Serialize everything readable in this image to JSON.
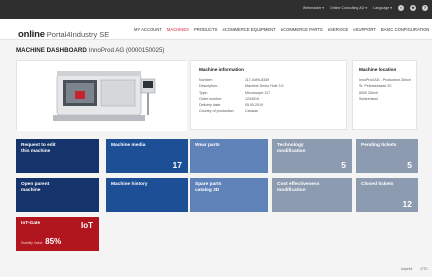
{
  "topbar": {
    "items": [
      "Webmaster ▾",
      "Online Consulting AG ▾",
      "Language ▾"
    ]
  },
  "header": {
    "logo_bold": "online",
    "logo_rest": "Portal4Industry SE",
    "nav": [
      "MY ACCOUNT",
      "MACHINES",
      "PRODUCTS",
      "eCOMMERCE EQUIPMENT",
      "eCOMMERCE PARTS",
      "eSERVICE",
      "eSUPPORT",
      "BASIC CONFIGURATION"
    ],
    "active_nav": "MACHINES"
  },
  "page": {
    "title": "MACHINE DASHBOARD",
    "subtitle": "InnoProd AG (0000150025)"
  },
  "machine_info": {
    "title": "Machine information",
    "rows": [
      {
        "key": "Number:",
        "value": "117-0495-8339"
      },
      {
        "key": "Description:",
        "value": "Machine Demo Hole 3.5"
      },
      {
        "key": "Type:",
        "value": "Microscope 117"
      },
      {
        "key": "Order number:",
        "value": "1234519"
      },
      {
        "key": "Delivery date:",
        "value": "05.05.2019"
      },
      {
        "key": "Country of production:",
        "value": "Canada"
      }
    ]
  },
  "machine_location": {
    "title": "Machine location",
    "lines": [
      "InnoProd AG - Production Zürich",
      "St. Petersstrasse 20",
      "8000 Zürich",
      "Switzerland"
    ]
  },
  "tiles": [
    {
      "label": "Request to edit\nthis machine",
      "count": ""
    },
    {
      "label": "Machine media",
      "count": "17"
    },
    {
      "label": "Wear parts",
      "count": ""
    },
    {
      "label": "Technology\nmodification",
      "count": "5"
    },
    {
      "label": "Pending tickets",
      "count": "5"
    },
    {
      "label": "Open parent\nmachine",
      "count": ""
    },
    {
      "label": "Machine history",
      "count": ""
    },
    {
      "label": "Spare parts\ncatalog 3D",
      "count": ""
    },
    {
      "label": "Cost effectiveness\nmodification",
      "count": ""
    },
    {
      "label": "Closed tickets",
      "count": "12"
    }
  ],
  "iot": {
    "label": "IoT-Gate",
    "badge": "IoT",
    "stability_label": "Stability Value:",
    "stability_value": "85%"
  },
  "footer": {
    "links": [
      "Imprint",
      "GTC"
    ]
  },
  "colors": {
    "accent_red": "#d3283c",
    "tile_blue": "#1c4f96",
    "tile_navy": "#16346c",
    "tile_light_blue": "#5f82b8",
    "tile_grey": "#8d9bb0",
    "iot_red": "#b1151d"
  },
  "icons": {
    "topbar": [
      "cart-icon",
      "star-icon",
      "help-icon"
    ]
  }
}
